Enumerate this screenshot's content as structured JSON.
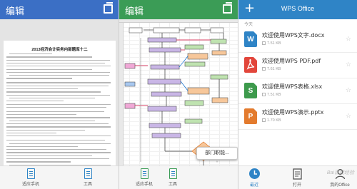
{
  "panel1": {
    "title": "编辑",
    "bar_color": "#3b6fc5",
    "doc_title": "2013经济会计实务内部题库十二",
    "bottom": [
      "适应手机",
      "工具"
    ]
  },
  "panel2": {
    "title": "编辑",
    "bar_color": "#3b9c56",
    "bottom": [
      "适应手机",
      "工具"
    ],
    "popup": "部门职能..."
  },
  "panel3": {
    "app_title": "WPS Office",
    "bar_color": "#2f84c6",
    "plus_label": "+",
    "section": "今天",
    "files": [
      {
        "name": "欢迎使用WPS文字.docx",
        "size": "7.51 KB",
        "icon_letter": "W",
        "color": "#2f84c6"
      },
      {
        "name": "欢迎使用WPS PDF.pdf",
        "size": "7.61 KB",
        "icon_letter": "",
        "color": "#e2463b"
      },
      {
        "name": "欢迎使用WPS表格.xlsx",
        "size": "7.51 KB",
        "icon_letter": "S",
        "color": "#3d9a4c"
      },
      {
        "name": "欢迎使用WPS演示.pptx",
        "size": "1.70 KB",
        "icon_letter": "P",
        "color": "#e37b2e"
      }
    ],
    "bottom": [
      "最近",
      "打开",
      "我的Office"
    ],
    "watermark": "Bai百度经验"
  }
}
